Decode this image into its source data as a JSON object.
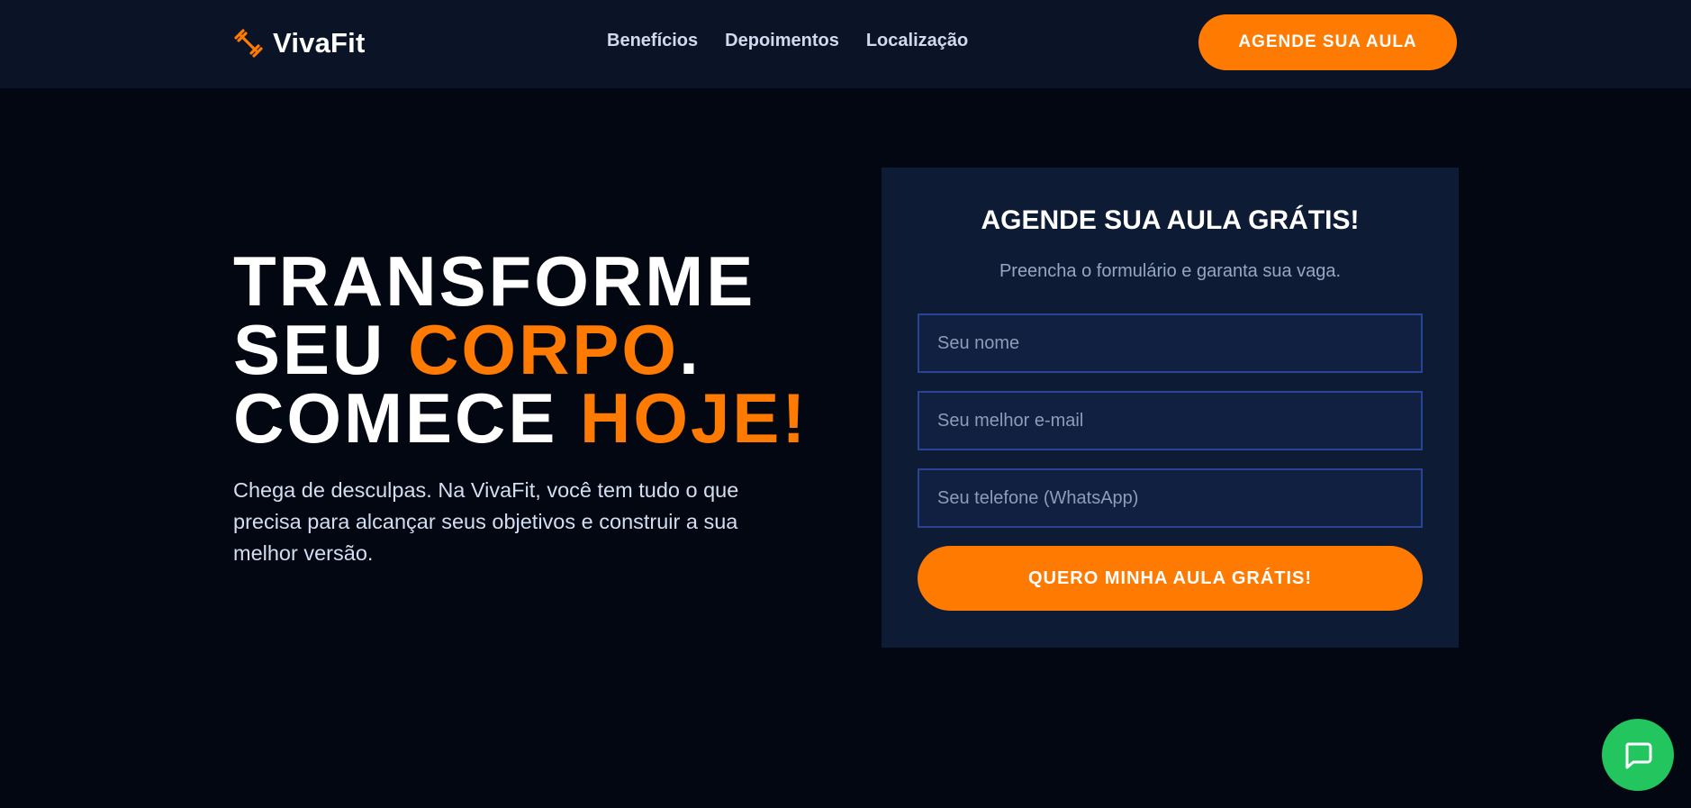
{
  "brand": {
    "name": "VivaFit",
    "icon": "dumbbell-icon",
    "accent_color": "#ff7a00"
  },
  "nav": {
    "links": [
      "Benefícios",
      "Depoimentos",
      "Localização"
    ],
    "cta_label": "AGENDE SUA AULA"
  },
  "hero": {
    "line1": "TRANSFORME",
    "line2_prefix": "SEU ",
    "line2_accent": "CORPO",
    "line2_suffix": ".",
    "line3_prefix": "COMECE ",
    "line3_accent": "HOJE!",
    "description": "Chega de desculpas. Na VivaFit, você tem tudo o que precisa para alcançar seus objetivos e construir a sua melhor versão."
  },
  "form": {
    "title": "AGENDE SUA AULA GRÁTIS!",
    "subtitle": "Preencha o formulário e garanta sua vaga.",
    "name_placeholder": "Seu nome",
    "email_placeholder": "Seu melhor e-mail",
    "phone_placeholder": "Seu telefone (WhatsApp)",
    "submit_label": "QUERO MINHA AULA GRÁTIS!"
  },
  "chat": {
    "icon": "chat-bubble-icon",
    "color": "#22c55e"
  }
}
